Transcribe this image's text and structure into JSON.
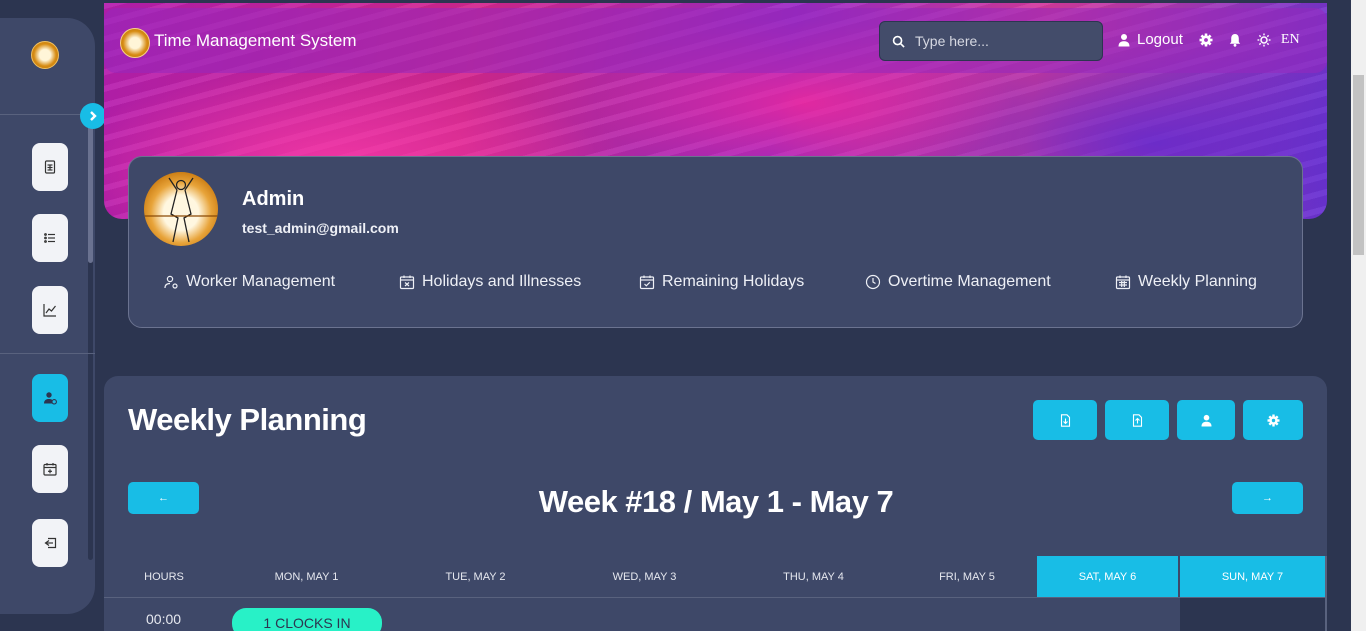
{
  "app": {
    "title": "Time Management System"
  },
  "search": {
    "placeholder": "Type here..."
  },
  "topbar": {
    "logout_label": "Logout",
    "language": "EN"
  },
  "sidebar": {
    "items": [
      {
        "icon": "document-table-icon"
      },
      {
        "icon": "list-icon"
      },
      {
        "icon": "chart-line-icon"
      },
      {
        "icon": "user-settings-icon",
        "active": true
      },
      {
        "icon": "calendar-plus-icon"
      },
      {
        "icon": "exit-icon"
      }
    ]
  },
  "profile": {
    "name": "Admin",
    "email": "test_admin@gmail.com",
    "nav": [
      {
        "label": "Worker Management",
        "icon": "user-gear-icon"
      },
      {
        "label": "Holidays and Illnesses",
        "icon": "calendar-x-icon"
      },
      {
        "label": "Remaining Holidays",
        "icon": "calendar-check-icon"
      },
      {
        "label": "Overtime Management",
        "icon": "clock-icon"
      },
      {
        "label": "Weekly Planning",
        "icon": "calendar-grid-icon"
      }
    ]
  },
  "planning": {
    "title": "Weekly Planning",
    "tools": [
      "file-download-icon",
      "file-upload-icon",
      "user-icon",
      "gear-icon"
    ],
    "prev": "←",
    "next": "→",
    "week_label": "Week #18 / May 1 - May 7",
    "columns": [
      "HOURS",
      "MON, MAY 1",
      "TUE, MAY 2",
      "WED, MAY 3",
      "THU, MAY 4",
      "FRI, MAY 5",
      "SAT, MAY 6",
      "SUN, MAY 7"
    ],
    "rows": [
      {
        "hour": "00:00",
        "mon_event": "1 CLOCKS IN"
      }
    ]
  },
  "colors": {
    "accent": "#18bde6",
    "event": "#28f1c7",
    "card": "#3e4868",
    "background": "#2c3550"
  }
}
